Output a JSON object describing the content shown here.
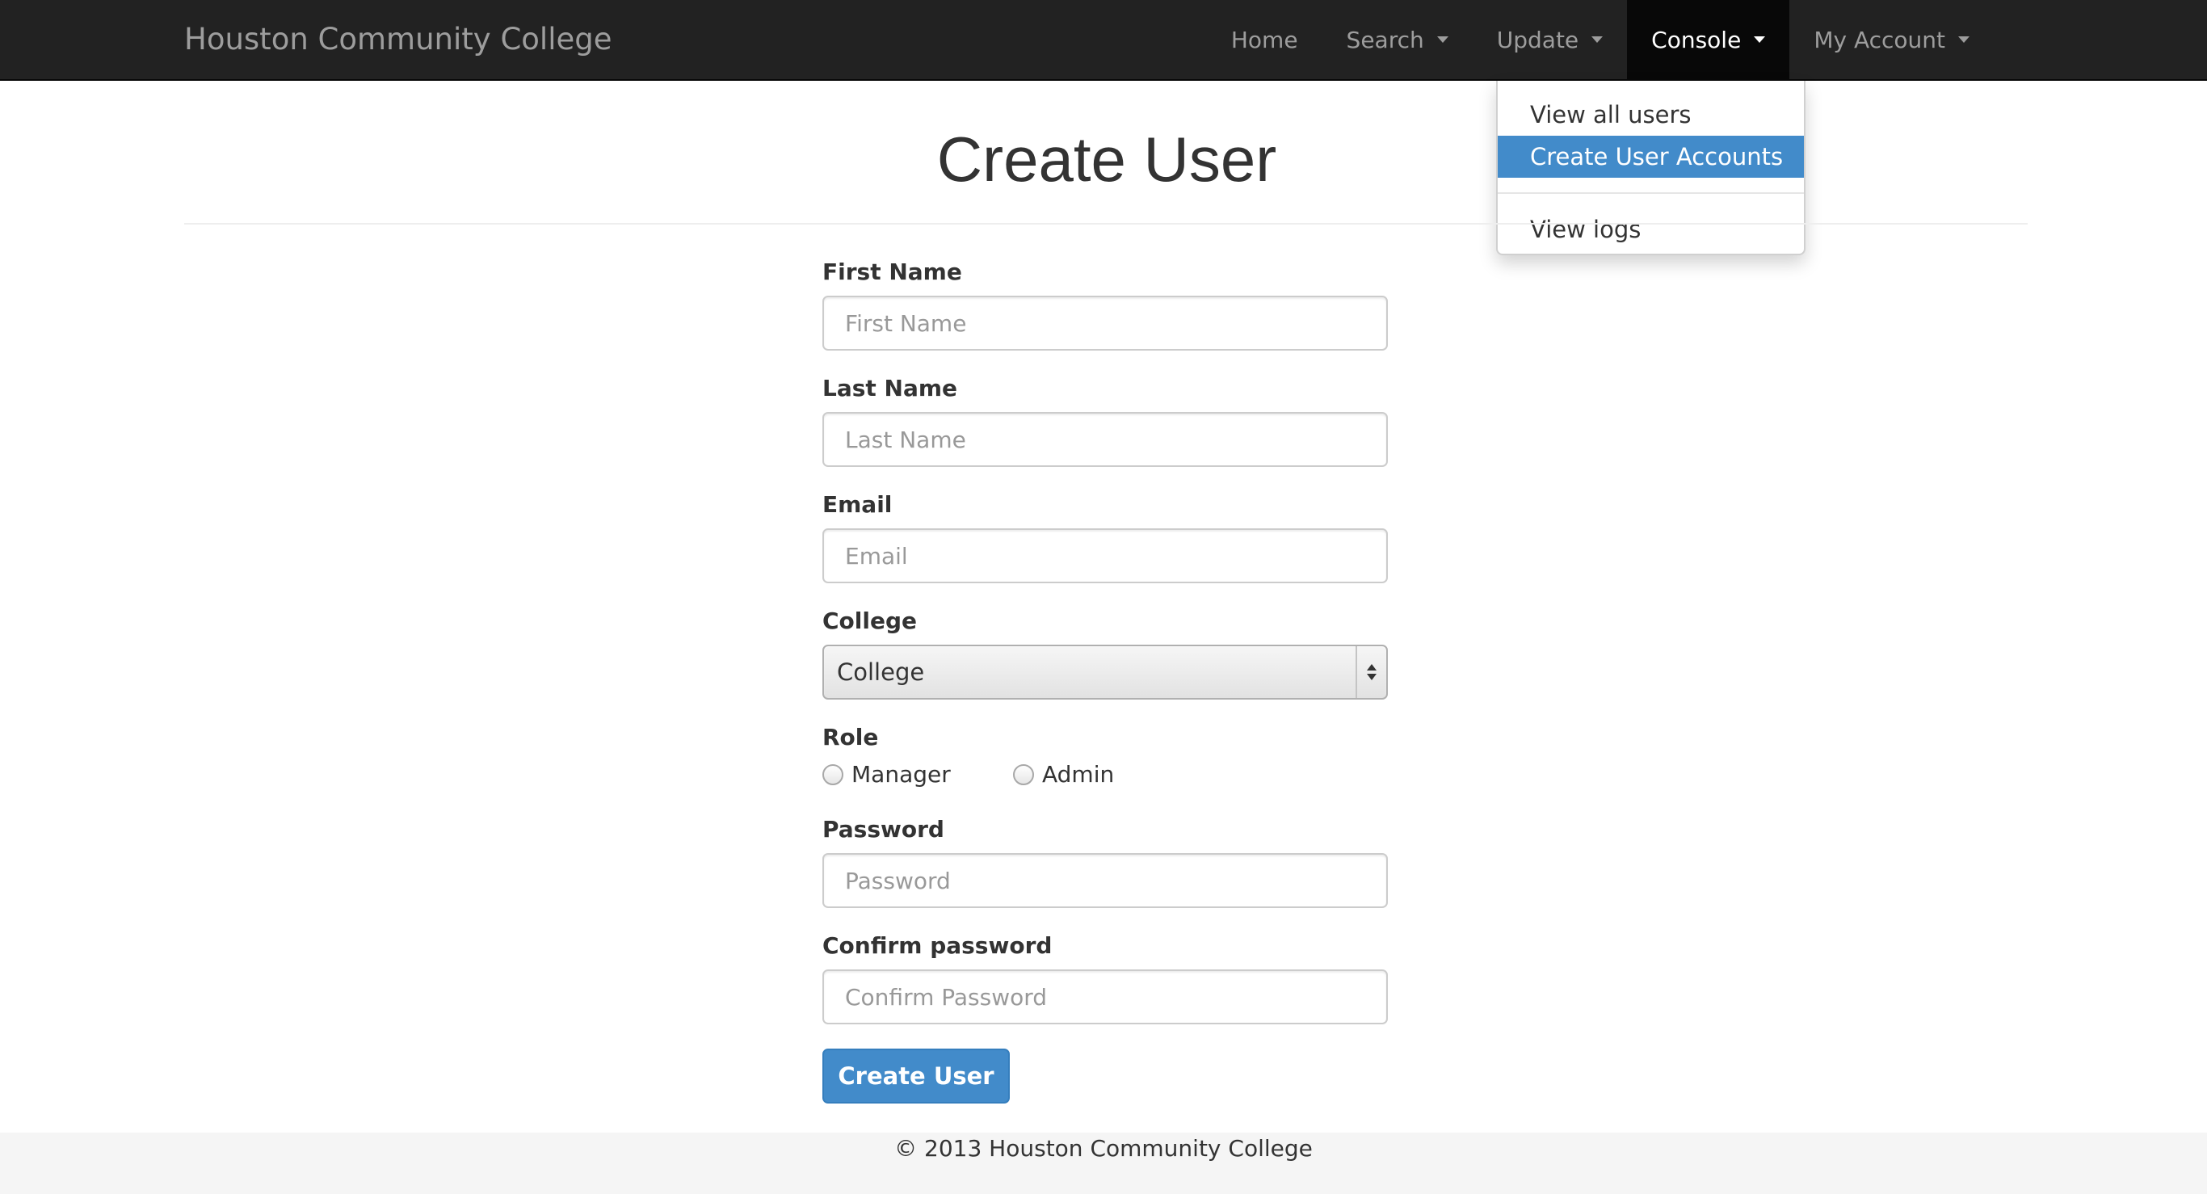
{
  "navbar": {
    "brand": "Houston Community College",
    "items": [
      {
        "label": "Home",
        "has_caret": false,
        "active": false
      },
      {
        "label": "Search",
        "has_caret": true,
        "active": false
      },
      {
        "label": "Update",
        "has_caret": true,
        "active": false
      },
      {
        "label": "Console",
        "has_caret": true,
        "active": true
      },
      {
        "label": "My Account",
        "has_caret": true,
        "active": false
      }
    ],
    "active_bg": "#080808"
  },
  "console_menu": {
    "items": [
      {
        "label": "View all users"
      },
      {
        "label": "Create User Accounts",
        "highlighted": true
      },
      {
        "label": "View logs"
      }
    ],
    "highlight_color": "#428bca"
  },
  "page": {
    "title": "Create User"
  },
  "form": {
    "first_name": {
      "label": "First Name",
      "placeholder": "First Name",
      "value": ""
    },
    "last_name": {
      "label": "Last Name",
      "placeholder": "Last Name",
      "value": ""
    },
    "email": {
      "label": "Email",
      "placeholder": "Email",
      "value": ""
    },
    "college": {
      "label": "College",
      "selected": "College"
    },
    "role": {
      "label": "Role",
      "options": [
        {
          "label": "Manager",
          "checked": false
        },
        {
          "label": "Admin",
          "checked": false
        }
      ]
    },
    "password": {
      "label": "Password",
      "placeholder": "Password",
      "value": ""
    },
    "confirm_password": {
      "label": "Confirm password",
      "placeholder": "Confirm Password",
      "value": ""
    },
    "submit_label": "Create User",
    "submit_color": "#428bca"
  },
  "footer": {
    "text": "© 2013 Houston Community College"
  }
}
